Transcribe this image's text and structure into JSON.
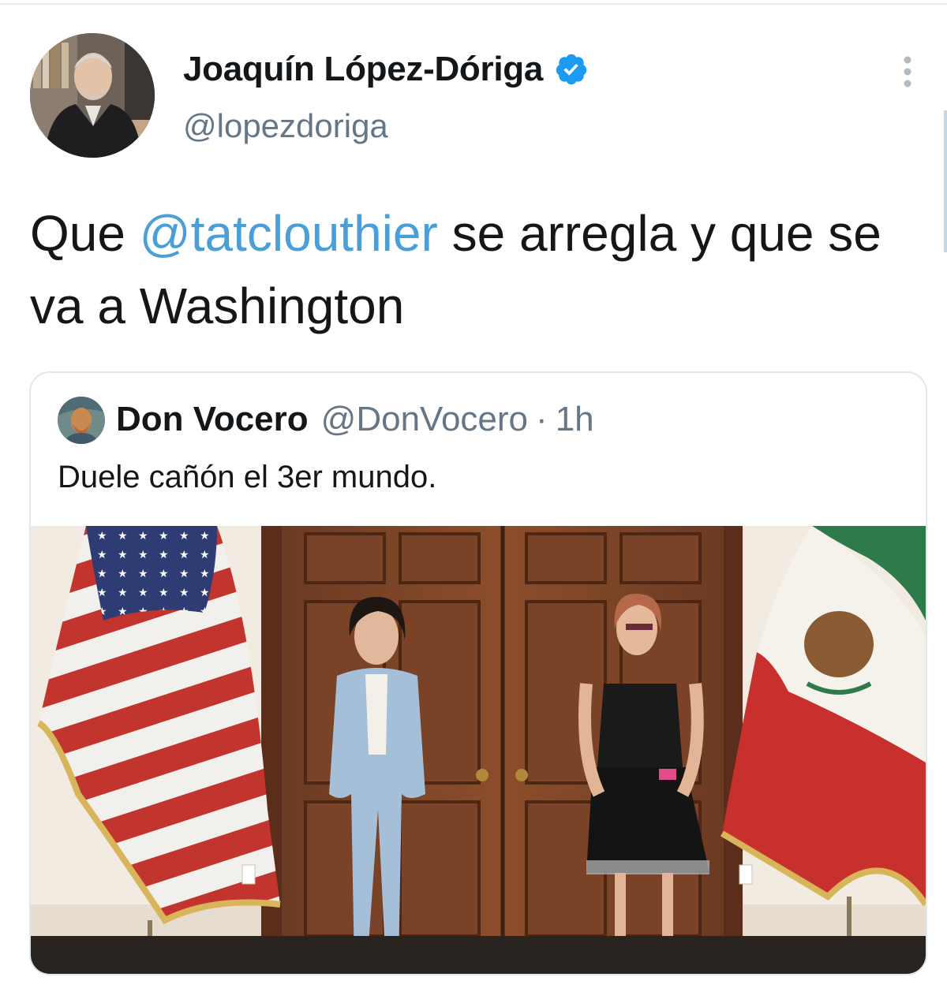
{
  "tweet": {
    "author": {
      "name": "Joaquín López-Dóriga",
      "handle": "@lopezdoriga",
      "verified": true,
      "avatar_icon": "profile-photo"
    },
    "text_prefix": "Que ",
    "mention": "@tatclouthier",
    "text_suffix": " se arregla y que se va a Washington",
    "more_icon": "more-vertical-icon"
  },
  "quoted": {
    "name": "Don Vocero",
    "handle": "@DonVocero",
    "separator": "·",
    "time": "1h",
    "text": "Duele cañón el 3er mundo.",
    "avatar_icon": "portrait-painting",
    "photo": "two-women-standing-between-us-and-mexico-flags"
  },
  "colors": {
    "mention": "#4a9fd8",
    "verified_badge": "#1d9bf0",
    "secondary_text": "#657786",
    "card_border": "#e1e8ed"
  }
}
